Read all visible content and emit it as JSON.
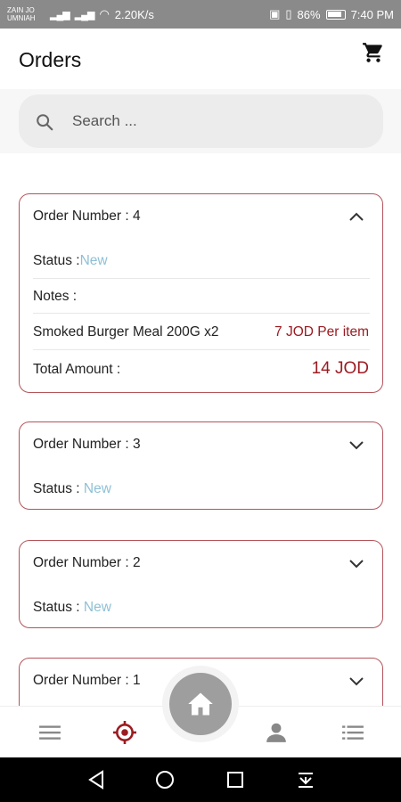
{
  "status_bar": {
    "carrier_line1": "ZAIN JO",
    "carrier_line2": "UMNIAH",
    "speed": "2.20K/s",
    "battery": "86%",
    "time": "7:40 PM"
  },
  "header": {
    "title": "Orders",
    "cart_icon": "cart-icon"
  },
  "search": {
    "placeholder": "Search ..."
  },
  "orders": [
    {
      "label": "Order Number  : 4",
      "expanded": true,
      "status_label": "Status :",
      "status_value": "New",
      "notes_label": "Notes :",
      "item_name": "Smoked Burger Meal 200G  x2",
      "item_price": "7 JOD Per item",
      "total_label": "Total Amount :",
      "total_value": "14 JOD"
    },
    {
      "label": "Order Number  : 3",
      "expanded": false,
      "status_label": "Status :",
      "status_value": "New"
    },
    {
      "label": "Order Number  : 2",
      "expanded": false,
      "status_label": "Status :",
      "status_value": "New"
    },
    {
      "label": "Order Number  : 1",
      "expanded": false
    }
  ],
  "colors": {
    "accent": "#9b1c22",
    "border": "#b3545a",
    "status_new": "#8ec0d6",
    "home_button": "#9e9e9e"
  },
  "bottom_nav": [
    "menu-icon",
    "target-icon",
    "home-icon",
    "profile-icon",
    "list-icon"
  ]
}
